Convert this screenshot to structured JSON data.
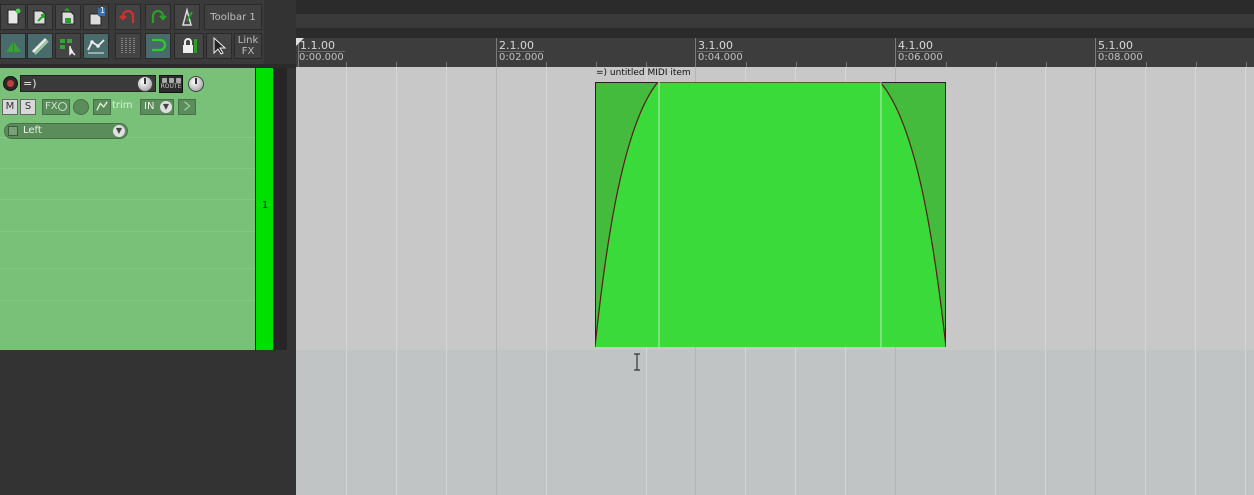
{
  "toolbar": {
    "title": "Toolbar 1",
    "link_fx_line1": "Link",
    "link_fx_line2": "FX",
    "badge": "1",
    "icons_row1": [
      "new-project-icon",
      "open-project-icon",
      "save-project-icon",
      "new-project-tab-icon",
      "undo-icon",
      "redo-icon",
      "metronome-icon"
    ],
    "icons_row2": [
      "split-icon",
      "ripple-edit-icon",
      "grid-snap-icon",
      "envelope-lock-icon",
      "grid-icon",
      "loop-icon",
      "lock-icon",
      "cursor-icon"
    ]
  },
  "track": {
    "name": "=)",
    "route_label": "ROUTE",
    "mute_label": "M",
    "solo_label": "S",
    "fx_label": "FX",
    "trim_label": "trim",
    "input_label": "IN",
    "envelope_label": "Left",
    "number": "1",
    "color": "#79c079"
  },
  "ruler": {
    "markers": [
      {
        "bar": "1.1.00",
        "time": "0:00.000"
      },
      {
        "bar": "2.1.00",
        "time": "0:02.000"
      },
      {
        "bar": "3.1.00",
        "time": "0:04.000"
      },
      {
        "bar": "4.1.00",
        "time": "0:06.000"
      },
      {
        "bar": "5.1.00",
        "time": "0:08.000"
      }
    ]
  },
  "item": {
    "title": "=) untitled MIDI item",
    "color": "#44bb3c"
  }
}
